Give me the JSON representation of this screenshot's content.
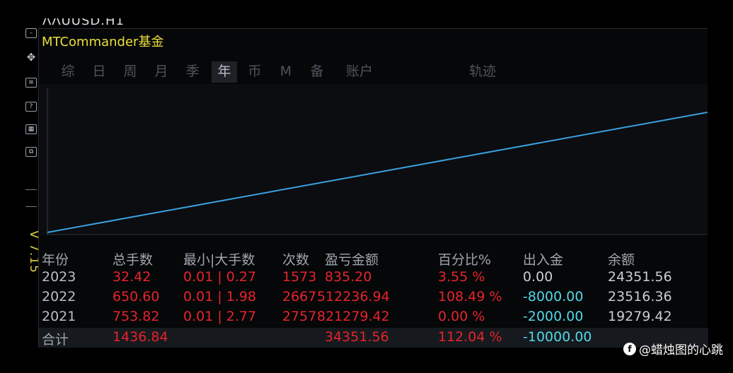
{
  "top_cut_text": "ΛΛUUSD.H1",
  "version_label": "V 7.15",
  "panel": {
    "title": "MTCommander基金",
    "tabs": [
      {
        "label": "综",
        "active": false
      },
      {
        "label": "日",
        "active": false
      },
      {
        "label": "周",
        "active": false
      },
      {
        "label": "月",
        "active": false
      },
      {
        "label": "季",
        "active": false
      },
      {
        "label": "年",
        "active": true
      },
      {
        "label": "币",
        "active": false
      },
      {
        "label": "M",
        "active": false
      },
      {
        "label": "备",
        "active": false
      },
      {
        "label": "账户",
        "active": false
      },
      {
        "label": "轨迹",
        "active": false
      }
    ]
  },
  "chart_data": {
    "type": "line",
    "line_color": "#3aa0e0",
    "series": [
      {
        "x": [
          0,
          1
        ],
        "y": [
          0,
          1
        ]
      }
    ]
  },
  "table": {
    "headers": [
      "年份",
      "总手数",
      "最小|大手数",
      "次数",
      "盈亏金额",
      "百分比%",
      "出入金",
      "余额"
    ],
    "rows": [
      {
        "year": "2023",
        "lots": "32.42",
        "min_max": "0.01 | 0.27",
        "count": "1573",
        "pnl": "835.20",
        "percent": "3.55 %",
        "deposit": "0.00",
        "balance": "24351.56"
      },
      {
        "year": "2022",
        "lots": "650.60",
        "min_max": "0.01 | 1.98",
        "count": "2667",
        "pnl": "512236.94",
        "percent": "108.49 %",
        "deposit": "-8000.00",
        "balance": "23516.36"
      },
      {
        "year": "2021",
        "lots": "753.82",
        "min_max": "0.01 | 2.77",
        "count": "2757",
        "pnl": "821279.42",
        "percent": "0.00 %",
        "deposit": "-2000.00",
        "balance": "19279.42"
      }
    ],
    "total": {
      "label": "合计",
      "lots": "1436.84",
      "pnl": "34351.56",
      "percent": "112.04 %",
      "deposit": "-10000.00"
    }
  },
  "colors": {
    "title": "#ecdf3c",
    "negative_red": "#e6242c",
    "cyan": "#50d8e8",
    "version": "#e2d23a"
  },
  "watermark": {
    "icon": "social-logo-icon",
    "text": "@蜡烛图的心跳"
  }
}
